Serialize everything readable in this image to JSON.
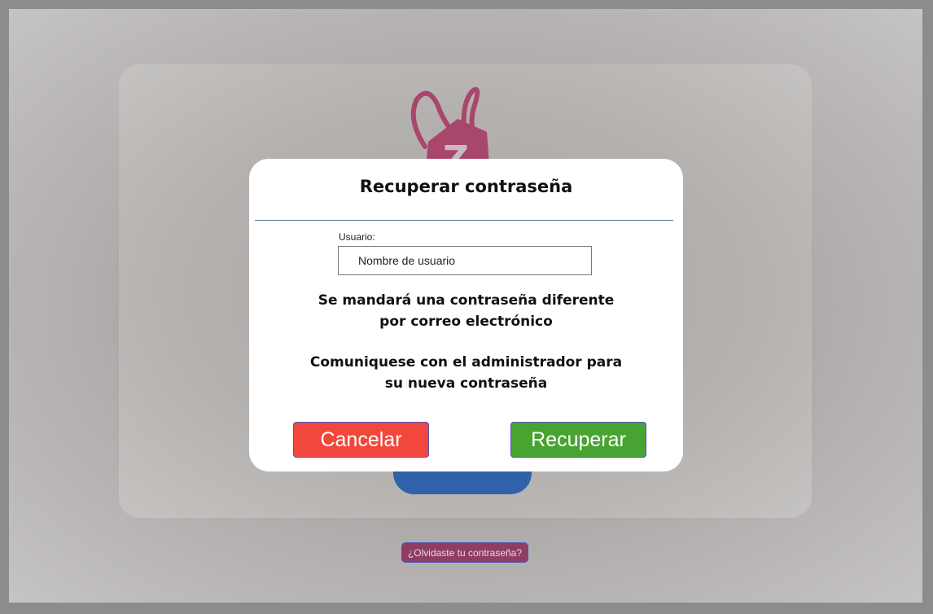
{
  "colors": {
    "brand_logo": "#a8466c",
    "cancel_button": "#f2473c",
    "recover_button": "#47a431",
    "login_button": "#2f62a8",
    "forgot_link": "#8f3d63"
  },
  "background": {
    "forgot_link_label": "¿Olvidaste tu contraseña?",
    "logo_icon": "clothes-tag-logo-icon",
    "logo_letter": "Z"
  },
  "modal": {
    "title": "Recuperar contraseña",
    "user_label": "Usuario:",
    "user_placeholder": "Nombre de usuario",
    "user_value": "",
    "info_line1": "Se mandará una contraseña diferente",
    "info_line2": "por correo electrónico",
    "info_line3": "Comuniquese con el administrador para",
    "info_line4": "su nueva contraseña",
    "cancel_label": "Cancelar",
    "recover_label": "Recuperar"
  }
}
